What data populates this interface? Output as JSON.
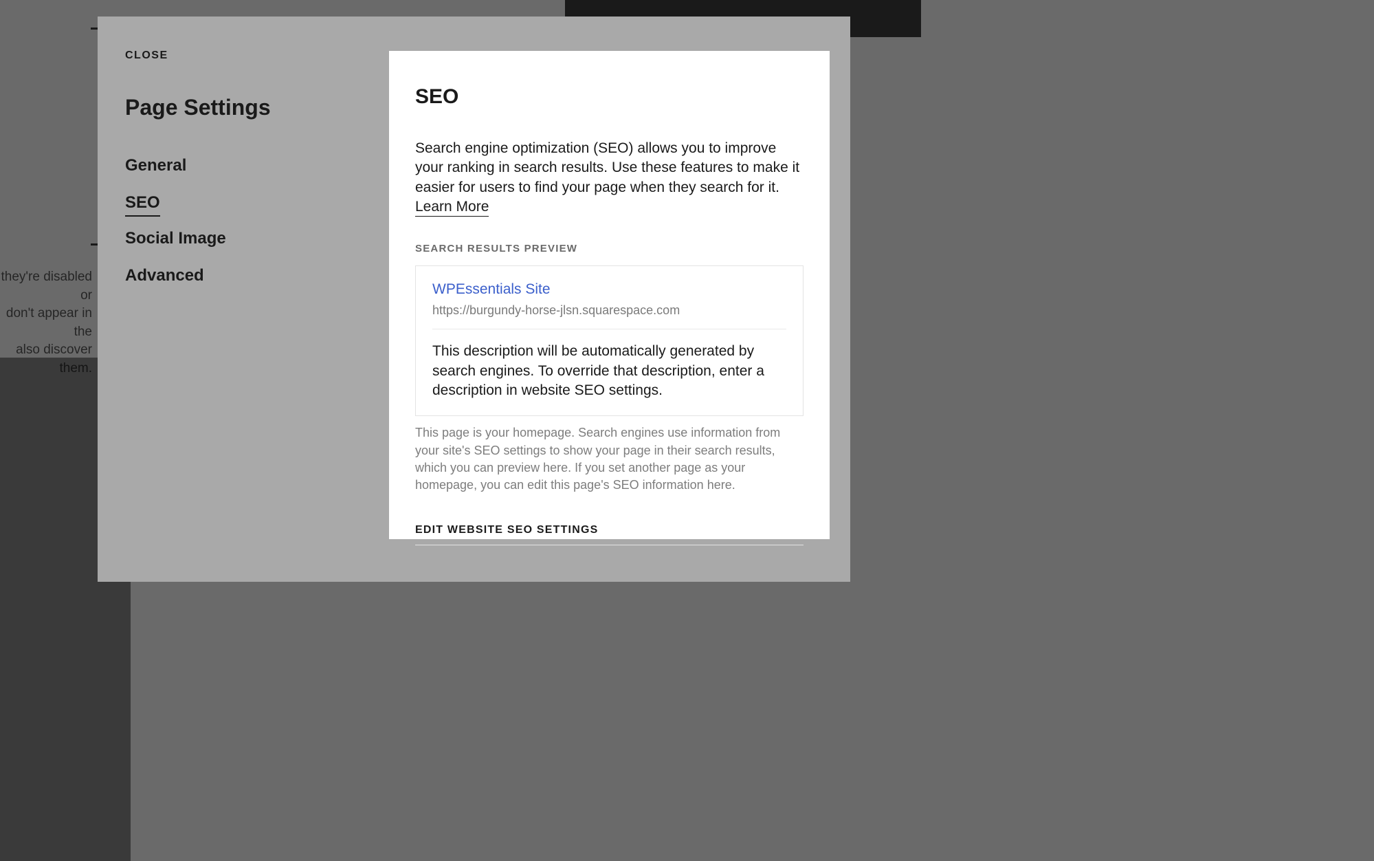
{
  "backdrop": {
    "line1": "they're disabled or",
    "line2": "don't appear in the",
    "line3": "also discover them."
  },
  "modal": {
    "close_label": "CLOSE",
    "title": "Page Settings",
    "nav": [
      {
        "label": "General",
        "active": false
      },
      {
        "label": "SEO",
        "active": true
      },
      {
        "label": "Social Image",
        "active": false
      },
      {
        "label": "Advanced",
        "active": false
      }
    ]
  },
  "seo": {
    "heading": "SEO",
    "description_prefix": "Search engine optimization (SEO) allows you to improve your ranking in search results. Use these features to make it easier for users to find your page when they search for it. ",
    "learn_more": "Learn More",
    "preview_label": "SEARCH RESULTS PREVIEW",
    "preview": {
      "title": "WPEssentials Site",
      "url": "https://burgundy-horse-jlsn.squarespace.com",
      "description": "This description will be automatically generated by search engines. To override that description, enter a description in website SEO settings."
    },
    "homepage_note": "This page is your homepage. Search engines use information from your site's SEO settings to show your page in their search results, which you can preview here. If you set another page as your homepage, you can edit this page's SEO information here.",
    "edit_link": "EDIT WEBSITE SEO SETTINGS"
  }
}
